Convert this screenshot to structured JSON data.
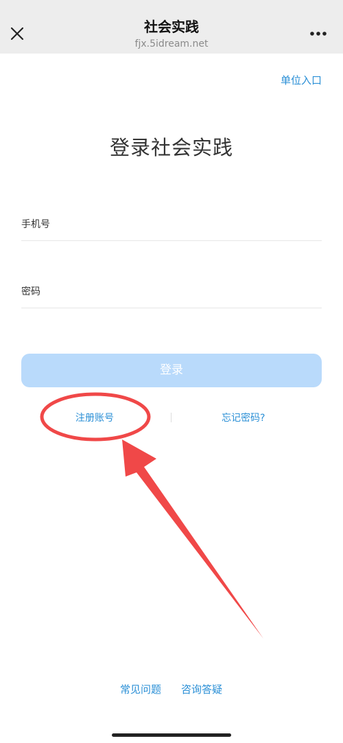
{
  "nav": {
    "title": "社会实践",
    "url": "fjx.5idream.net",
    "close_icon": "close-icon",
    "more_icon": "more-dots-icon"
  },
  "header": {
    "unit_entry": "单位入口",
    "title": "登录社会实践"
  },
  "form": {
    "phone_placeholder": "手机号",
    "password_placeholder": "密码",
    "login_label": "登录"
  },
  "links": {
    "register": "注册账号",
    "forgot": "忘记密码?"
  },
  "footer": {
    "faq": "常见问题",
    "consult": "咨询答疑"
  },
  "colors": {
    "link_blue": "#2a8fd6",
    "login_button_disabled": "#b9dafb",
    "annotation_red": "#f04848"
  }
}
